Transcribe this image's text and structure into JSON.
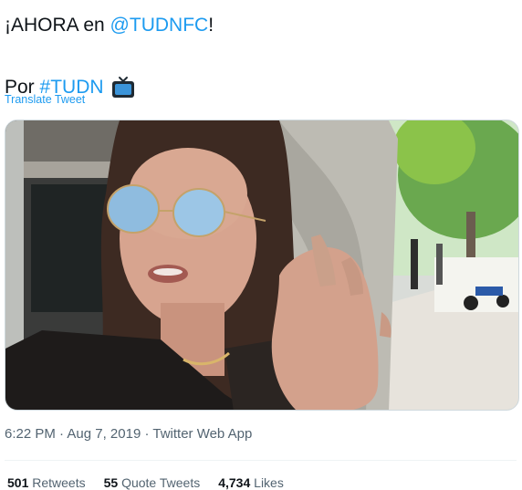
{
  "tweet": {
    "line1_prefix": "¡AHORA en ",
    "line1_mention": "@TUDNFC",
    "line1_suffix": "!",
    "line2_prefix": "Por ",
    "line2_hashtag": "#TUDN",
    "emoji_icon": "television-icon"
  },
  "translate_label": "Translate Tweet",
  "media": {
    "type": "video-thumbnail",
    "icon": "video-frame"
  },
  "meta": {
    "time": "6:22 PM",
    "dot1": " · ",
    "date": "Aug 7, 2019",
    "dot2": " · ",
    "app": "Twitter Web App"
  },
  "stats": {
    "retweets_count": "501",
    "retweets_label": "Retweets",
    "quotes_count": "55",
    "quotes_label": "Quote Tweets",
    "likes_count": "4,734",
    "likes_label": "Likes"
  },
  "colors": {
    "link": "#1d9bf0",
    "text": "#0f1419",
    "secondary": "#536471"
  }
}
